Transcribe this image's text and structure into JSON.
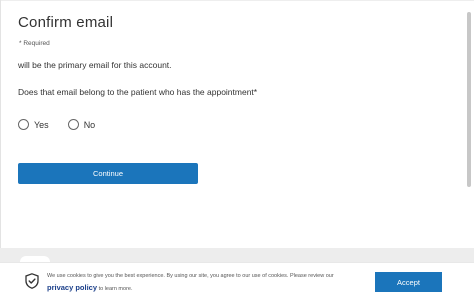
{
  "form": {
    "title": "Confirm email",
    "required_note": "* Required",
    "description": "will be the primary email for this account.",
    "question": "Does that email belong to the patient who has the appointment*",
    "options": [
      {
        "label": "Yes",
        "selected": false
      },
      {
        "label": "No",
        "selected": false
      }
    ],
    "continue_label": "Continue"
  },
  "cookie_banner": {
    "message": "We use cookies to give you the best experience. By using our site, you agree to our use of cookies. Please review our",
    "privacy_link": "privacy policy",
    "message_suffix": "to learn more.",
    "accept_label": "Accept",
    "icon": "shield-check-icon"
  },
  "colors": {
    "primary": "#1b75bb",
    "link": "#1b3f8a",
    "text": "#333333",
    "band": "#ededed"
  }
}
